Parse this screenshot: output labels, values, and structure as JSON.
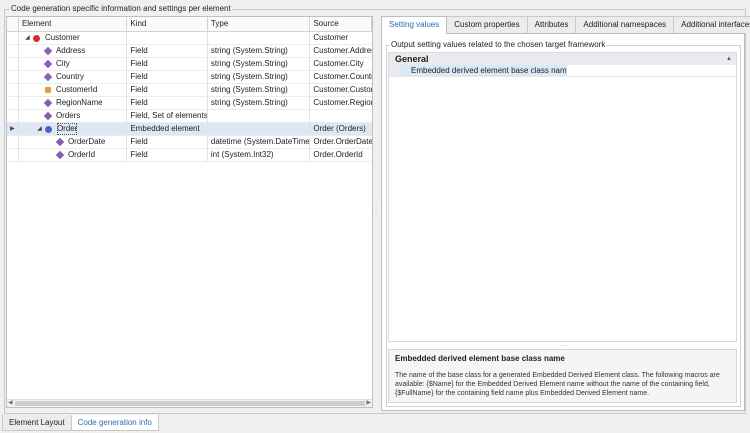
{
  "group_title": "Code generation specific information and settings per element",
  "grid": {
    "columns": [
      "Element",
      "Kind",
      "Type",
      "Source"
    ],
    "rows": [
      {
        "name": "Customer",
        "kind": "",
        "type": "",
        "source": "Customer",
        "icon": "entity-icon",
        "level": 0,
        "expander": "◢"
      },
      {
        "name": "Address",
        "kind": "Field",
        "type": "string (System.String)",
        "source": "Customer.Address",
        "icon": "field-icon",
        "level": 1
      },
      {
        "name": "City",
        "kind": "Field",
        "type": "string (System.String)",
        "source": "Customer.City",
        "icon": "field-icon",
        "level": 1
      },
      {
        "name": "Country",
        "kind": "Field",
        "type": "string (System.String)",
        "source": "Customer.Country",
        "icon": "field-icon",
        "level": 1
      },
      {
        "name": "CustomerId",
        "kind": "Field",
        "type": "string (System.String)",
        "source": "Customer.CustomerId",
        "icon": "pk-field-icon",
        "level": 1
      },
      {
        "name": "RegionName",
        "kind": "Field",
        "type": "string (System.String)",
        "source": "Customer.RegionName",
        "icon": "field-icon",
        "level": 1
      },
      {
        "name": "Orders",
        "kind": "Field, Set of elements",
        "type": "",
        "source": "",
        "icon": "field-icon",
        "level": 1
      },
      {
        "name": "Order",
        "kind": "Embedded element",
        "type": "",
        "source": "Order (Orders)",
        "icon": "embedded-element-icon",
        "level": 1,
        "expander": "◢",
        "selected": true
      },
      {
        "name": "OrderDate",
        "kind": "Field",
        "type": "datetime (System.DateTime)",
        "source": "Order.OrderDate",
        "icon": "field-icon",
        "level": 2
      },
      {
        "name": "OrderId",
        "kind": "Field",
        "type": "int (System.Int32)",
        "source": "Order.OrderId",
        "icon": "field-icon",
        "level": 2
      }
    ]
  },
  "tabs": [
    "Setting values",
    "Custom properties",
    "Attributes",
    "Additional namespaces",
    "Additional interfaces"
  ],
  "active_tab": "Setting values",
  "settings": {
    "group_title": "Output setting values related to the chosen target framework",
    "category": "General",
    "property_name": "Embedded derived element base class name",
    "property_value": ""
  },
  "description": {
    "title": "Embedded derived element base class name",
    "text": "The name of the base class for a generated Embedded Derived Element class. The following macros are available: {$Name} for the Embedded Derived Element name without the name of the containing field, {$FullName} for the containing field name plus Embedded Derived Element name."
  },
  "bottom_tabs": [
    "Element Layout",
    "Code generation info"
  ],
  "active_bottom_tab": "Code generation info"
}
